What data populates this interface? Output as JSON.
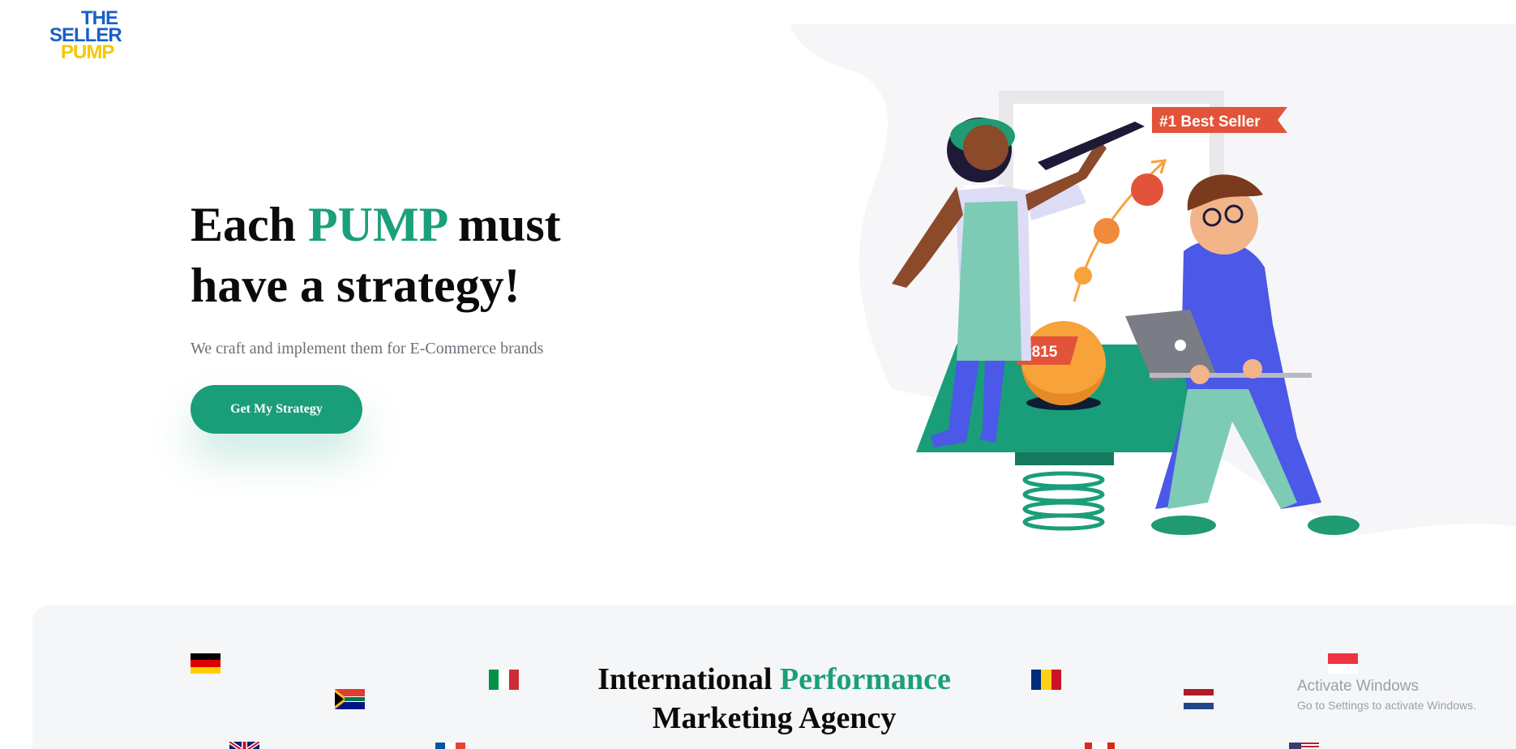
{
  "logo": {
    "line1": "THE",
    "line2": "SELLER",
    "line3": "PUMP"
  },
  "hero": {
    "title_part1": "Each ",
    "title_accent": "PUMP",
    "title_part2": " must have a strategy!",
    "subtitle": "We craft and implement them for E-Commerce brands",
    "cta_label": "Get My Strategy"
  },
  "illustration": {
    "badge_best_seller": "#1 Best Seller",
    "badge_rank": "#815"
  },
  "section2": {
    "title_part1": "International ",
    "title_accent": "Performance",
    "title_part2": "Marketing Agency"
  },
  "flags": [
    "germany",
    "south-africa",
    "italy",
    "uk",
    "france",
    "romania",
    "netherlands",
    "singapore",
    "canada",
    "usa"
  ],
  "watermark": {
    "line1": "Activate Windows",
    "line2": "Go to Settings to activate Windows."
  },
  "colors": {
    "accent": "#1aa07a",
    "button": "#1a9e79",
    "logo_blue": "#1a5fc8",
    "logo_yellow": "#f5c800",
    "badge_red": "#e2533a"
  }
}
